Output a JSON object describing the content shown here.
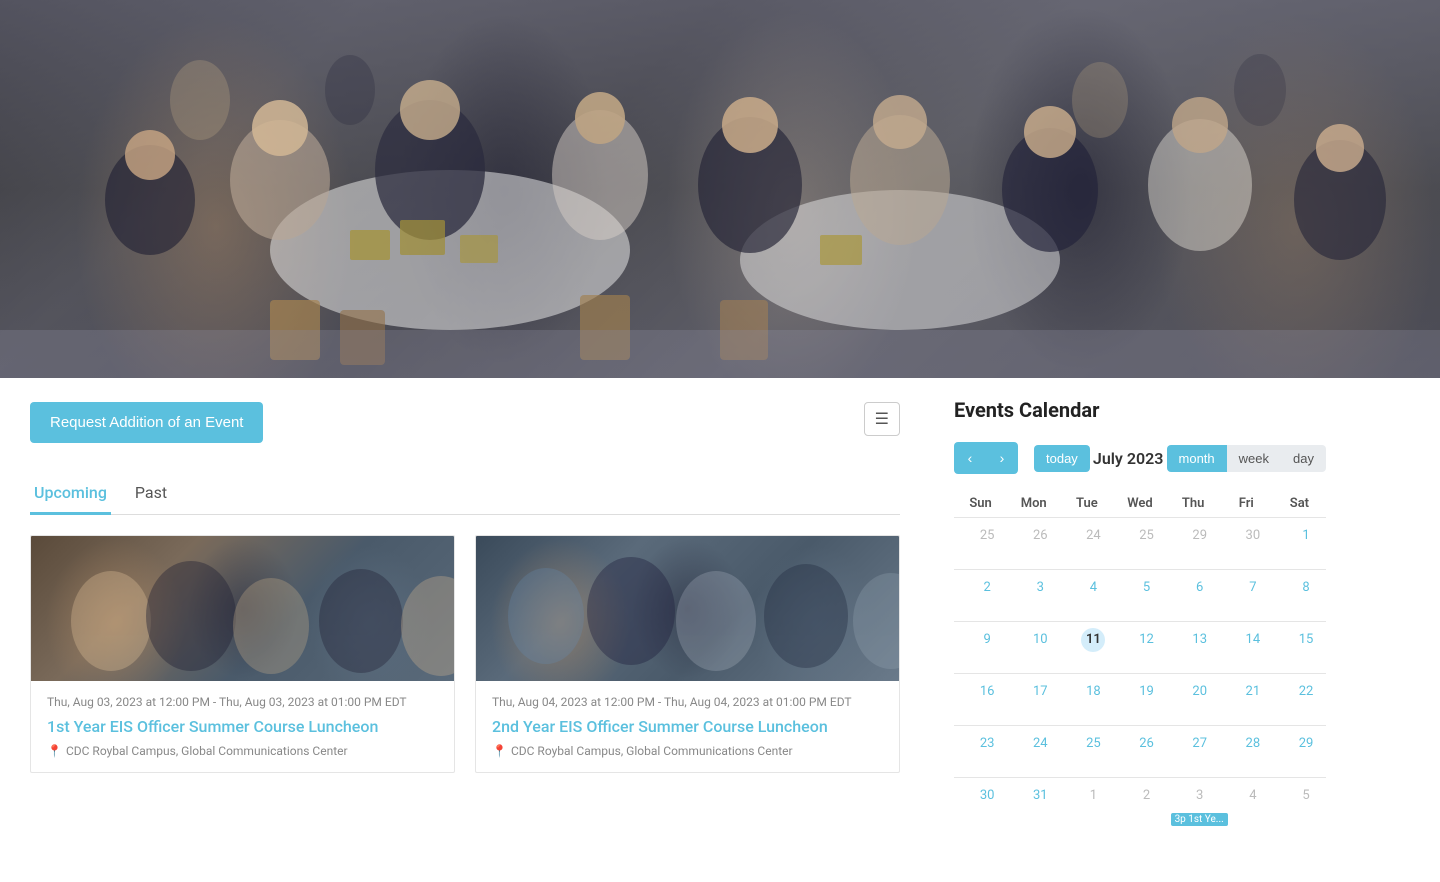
{
  "hero": {
    "alt": "Military luncheon event photo"
  },
  "request_button": {
    "label": "Request Addition of an Event"
  },
  "list_icon": "☰",
  "tabs": [
    {
      "id": "upcoming",
      "label": "Upcoming",
      "active": true
    },
    {
      "id": "past",
      "label": "Past",
      "active": false
    }
  ],
  "events": [
    {
      "id": "event-1",
      "date": "Thu, Aug 03, 2023 at 12:00 PM - Thu, Aug 03, 2023 at 01:00 PM EDT",
      "title": "1st Year EIS Officer Summer Course Luncheon",
      "location": "CDC Roybal Campus, Global Communications Center"
    },
    {
      "id": "event-2",
      "date": "Thu, Aug 04, 2023 at 12:00 PM - Thu, Aug 04, 2023 at 01:00 PM EDT",
      "title": "2nd Year EIS Officer Summer Course Luncheon",
      "location": "CDC Roybal Campus, Global Communications Center"
    }
  ],
  "calendar": {
    "title": "Events Calendar",
    "month_label": "July 2023",
    "view_buttons": [
      {
        "id": "month",
        "label": "month",
        "active": true
      },
      {
        "id": "week",
        "label": "week",
        "active": false
      },
      {
        "id": "day",
        "label": "day",
        "active": false
      }
    ],
    "days_of_week": [
      "Sun",
      "Mon",
      "Tue",
      "Wed",
      "Thu",
      "Fri",
      "Sat"
    ],
    "weeks": [
      [
        {
          "num": "25",
          "type": "other"
        },
        {
          "num": "26",
          "type": "other"
        },
        {
          "num": "24",
          "type": "other"
        },
        {
          "num": "25",
          "type": "other"
        },
        {
          "num": "29",
          "type": "other"
        },
        {
          "num": "30",
          "type": "other"
        },
        {
          "num": "1",
          "type": "current"
        }
      ],
      [
        {
          "num": "2",
          "type": "current"
        },
        {
          "num": "3",
          "type": "current"
        },
        {
          "num": "4",
          "type": "current"
        },
        {
          "num": "5",
          "type": "current"
        },
        {
          "num": "6",
          "type": "current"
        },
        {
          "num": "7",
          "type": "current"
        },
        {
          "num": "8",
          "type": "current"
        }
      ],
      [
        {
          "num": "9",
          "type": "current"
        },
        {
          "num": "10",
          "type": "current"
        },
        {
          "num": "11",
          "type": "today"
        },
        {
          "num": "12",
          "type": "current"
        },
        {
          "num": "13",
          "type": "current"
        },
        {
          "num": "14",
          "type": "current"
        },
        {
          "num": "15",
          "type": "current"
        }
      ],
      [
        {
          "num": "16",
          "type": "current"
        },
        {
          "num": "17",
          "type": "current"
        },
        {
          "num": "18",
          "type": "current"
        },
        {
          "num": "19",
          "type": "current"
        },
        {
          "num": "20",
          "type": "current"
        },
        {
          "num": "21",
          "type": "current"
        },
        {
          "num": "22",
          "type": "current"
        }
      ],
      [
        {
          "num": "23",
          "type": "current"
        },
        {
          "num": "24",
          "type": "current"
        },
        {
          "num": "25",
          "type": "current"
        },
        {
          "num": "26",
          "type": "current"
        },
        {
          "num": "27",
          "type": "current"
        },
        {
          "num": "28",
          "type": "current"
        },
        {
          "num": "29",
          "type": "current"
        }
      ],
      [
        {
          "num": "30",
          "type": "current"
        },
        {
          "num": "31",
          "type": "current"
        },
        {
          "num": "1",
          "type": "other"
        },
        {
          "num": "2",
          "type": "other"
        },
        {
          "num": "3",
          "type": "other",
          "event": "3p 1st Ye..."
        },
        {
          "num": "4",
          "type": "other"
        },
        {
          "num": "5",
          "type": "other"
        }
      ]
    ],
    "nav": {
      "prev_label": "‹",
      "next_label": "›",
      "today_label": "today"
    }
  }
}
